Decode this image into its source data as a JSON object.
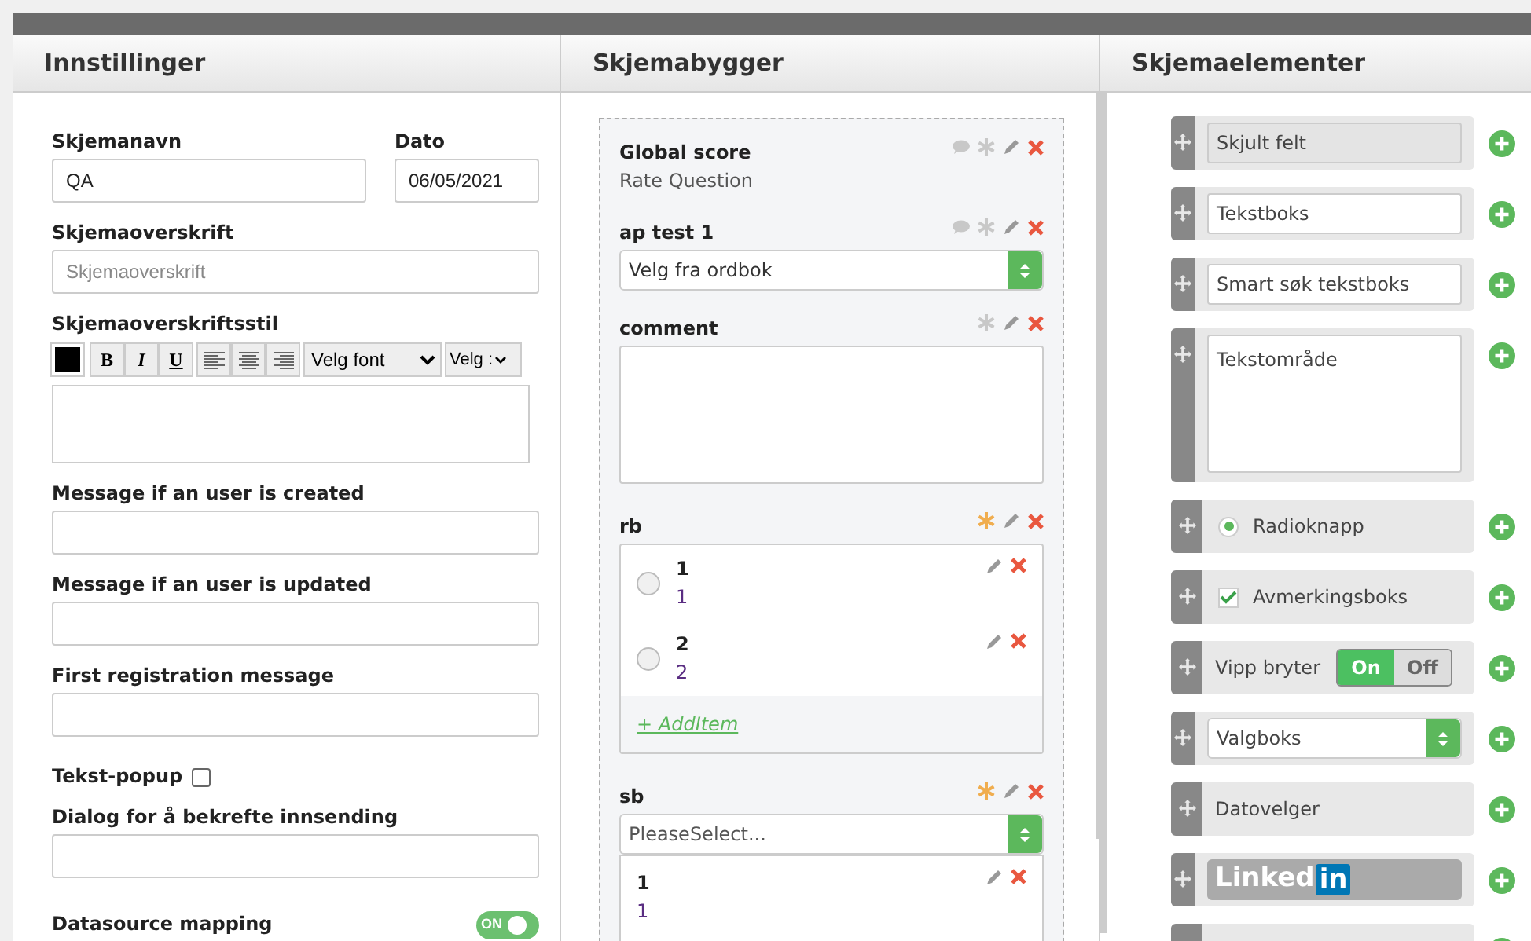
{
  "panels": [
    {
      "title": "Innstillinger"
    },
    {
      "title": "Skjemabygger"
    },
    {
      "title": "Skjemaelementer"
    }
  ],
  "settings": {
    "name": {
      "label": "Skjemanavn",
      "value": "QA"
    },
    "date": {
      "label": "Dato",
      "value": "06/05/2021"
    },
    "heading": {
      "label": "Skjemaoverskrift",
      "placeholder": "Skjemaoverskrift"
    },
    "style": {
      "label": "Skjemaoverskriftsstil",
      "bold": "B",
      "italic": "I",
      "underline": "U",
      "font": "Velg font",
      "size": "Velg :"
    },
    "messages": [
      {
        "label": "Message if an user is created"
      },
      {
        "label": "Message if an user is updated"
      },
      {
        "label": "First registration message"
      }
    ],
    "popup": {
      "label": "Tekst-popup",
      "checked": false
    },
    "dialog": {
      "label": "Dialog for å bekrefte innsending"
    },
    "datasource": {
      "label": "Datasource mapping",
      "on": true,
      "text": "ON"
    }
  },
  "builder": [
    {
      "kind": "rating",
      "title": "Global score",
      "subtitle": "Rate Question",
      "commentable": true,
      "required": false
    },
    {
      "kind": "dropdown",
      "title": "ap test 1",
      "value": "Velg fra ordbok",
      "commentable": true,
      "required": false
    },
    {
      "kind": "textarea",
      "title": "comment",
      "commentable": false,
      "required": false
    },
    {
      "kind": "radio",
      "title": "rb",
      "commentable": false,
      "required": true,
      "options": [
        {
          "label": "1",
          "value": "1",
          "selected": false
        },
        {
          "label": "2",
          "value": "2",
          "selected": false
        }
      ],
      "add": "+ AddItem"
    },
    {
      "kind": "select",
      "title": "sb",
      "placeholder": "PleaseSelect...",
      "commentable": false,
      "required": true,
      "options": [
        {
          "label": "1",
          "value": "1"
        }
      ]
    }
  ],
  "elements": [
    {
      "kind": "hidden",
      "label": "Skjult felt"
    },
    {
      "kind": "textbox",
      "label": "Tekstboks"
    },
    {
      "kind": "textbox",
      "label": "Smart søk tekstboks"
    },
    {
      "kind": "textarea",
      "label": "Tekstområde"
    },
    {
      "kind": "radio",
      "label": "Radioknapp",
      "checked": true
    },
    {
      "kind": "checkbox",
      "label": "Avmerkingsboks",
      "checked": true
    },
    {
      "kind": "toggle",
      "label": "Vipp bryter",
      "on_label": "On",
      "off_label": "Off",
      "on": true
    },
    {
      "kind": "select",
      "label": "Valgboks"
    },
    {
      "kind": "date",
      "label": "Datovelger"
    },
    {
      "kind": "linkedin",
      "label": "Linked",
      "badge": "in"
    },
    {
      "kind": "blank"
    }
  ]
}
